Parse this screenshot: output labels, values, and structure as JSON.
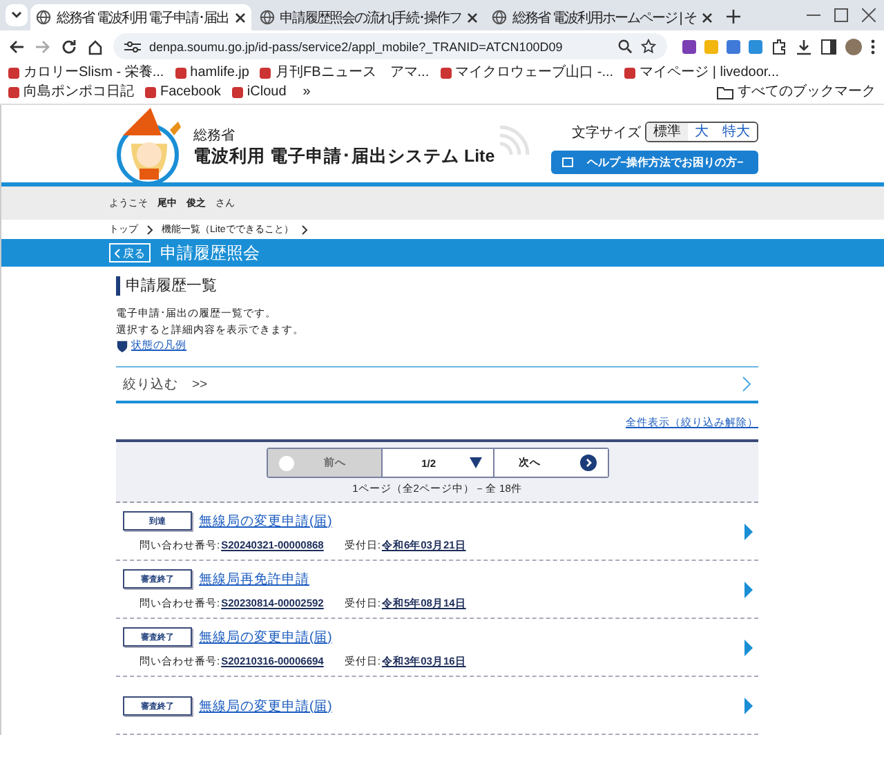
{
  "browser": {
    "tabs": [
      {
        "title": "総務省 電波利用 電子申請･届出",
        "selected": true
      },
      {
        "title": "申請履歴照会の流れ|手続･操作フ",
        "selected": false
      },
      {
        "title": "総務省 電波利用ホームページ | そ",
        "selected": false
      }
    ],
    "url": "denpa.soumu.go.jp/id-pass/service2/appl_mobile?_TRANID=ATCN100D09",
    "bookmarks": [
      "カロリーSlism - 栄養...",
      "hamlife.jp",
      "月刊FBニュース　アマ...",
      "マイクロウェーブ山口 -...",
      "マイページ | livedoor...",
      "向島ポンポコ日記",
      "Facebook",
      "iCloud"
    ],
    "bookmarks_more": "»",
    "all_bookmarks": "すべてのブックマーク"
  },
  "header": {
    "ministry": "総務省",
    "system_title": "電波利用 電子申請･届出システム Lite",
    "font_size_label": "文字サイズ",
    "font_sizes": [
      {
        "label": "標準",
        "selected": true
      },
      {
        "label": "大",
        "selected": false
      },
      {
        "label": "特大",
        "selected": false
      }
    ],
    "help_button": "ヘルプ−操作方法でお困りの方−"
  },
  "user_bar": {
    "welcome": "ようこそ",
    "last_name": "尾中",
    "first_name": "俊之",
    "suffix": "さん"
  },
  "breadcrumb": [
    "トップ",
    "機能一覧（Liteでできること）"
  ],
  "page_bar": {
    "back": "戻る",
    "title": "申請履歴照会"
  },
  "section": {
    "title": "申請履歴一覧",
    "description": [
      "電子申請･届出の履歴一覧です。",
      "選択すると詳細内容を表示できます。"
    ],
    "legend_link": "状態の凡例"
  },
  "filter": {
    "label": "絞り込む　>>"
  },
  "show_all_link": "全件表示（絞り込み解除）",
  "pager": {
    "prev": "前へ",
    "prev_disabled": true,
    "page": "1/2",
    "next": "次へ",
    "summary": "1ページ（全2ページ中）－全 18件"
  },
  "records": [
    {
      "status": "到達",
      "title": "無線局の変更申請(届)",
      "inquiry_label": "問い合わせ番号:",
      "inquiry_no": "S20240321-00000868",
      "date_label": "受付日:",
      "date": "令和6年03月21日"
    },
    {
      "status": "審査終了",
      "title": "無線局再免許申請",
      "inquiry_label": "問い合わせ番号:",
      "inquiry_no": "S20230814-00002592",
      "date_label": "受付日:",
      "date": "令和5年08月14日"
    },
    {
      "status": "審査終了",
      "title": "無線局の変更申請(届)",
      "inquiry_label": "問い合わせ番号:",
      "inquiry_no": "S20210316-00006694",
      "date_label": "受付日:",
      "date": "令和3年03月16日"
    },
    {
      "status": "審査終了",
      "title": "無線局の変更申請(届)"
    }
  ]
}
